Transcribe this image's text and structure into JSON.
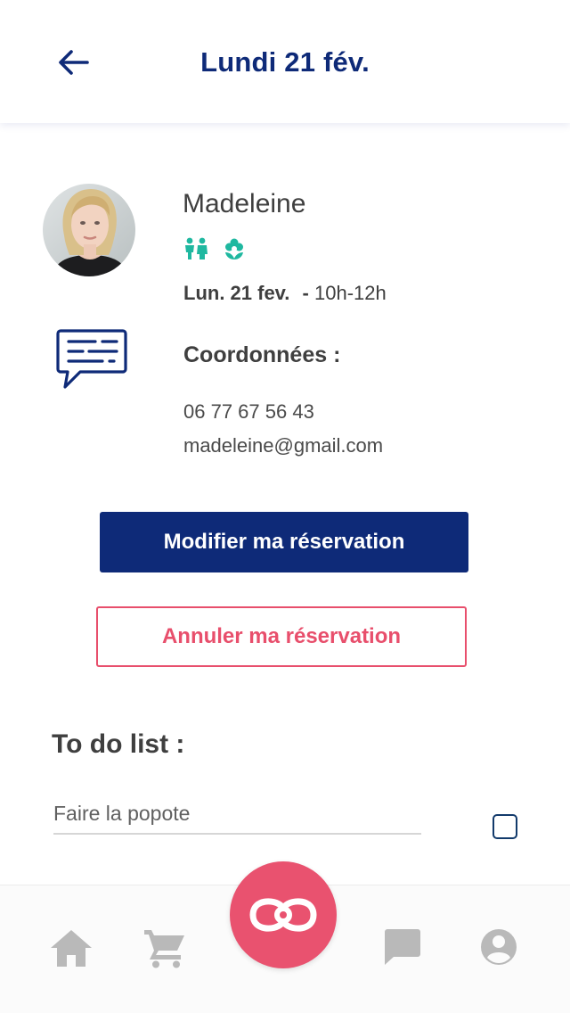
{
  "header": {
    "title": "Lundi 21 fév.",
    "back_icon": "arrow-left-icon",
    "title_color": "#0e2a78"
  },
  "booking": {
    "name": "Madeleine",
    "service_icons": [
      "children-icon",
      "flower-icon"
    ],
    "date": "Lun. 21 fev.",
    "separator": "-",
    "time": "10h-12h",
    "contact_label": "Coordonnées :",
    "phone": "06 77 67 56 43",
    "email": "madeleine@gmail.com"
  },
  "actions": {
    "modify_label": "Modifier ma réservation",
    "cancel_label": "Annuler ma réservation"
  },
  "todo": {
    "title": "To do list :",
    "item_placeholder": "Faire la popote",
    "item_checked": false
  },
  "nav": {
    "items": [
      "home-icon",
      "cart-icon",
      "infinity-logo-icon",
      "chat-icon",
      "account-icon"
    ],
    "fab_color": "#e9526f"
  },
  "colors": {
    "primary": "#0e2a78",
    "accent": "#e84f6c",
    "teal": "#1fb8a0"
  }
}
